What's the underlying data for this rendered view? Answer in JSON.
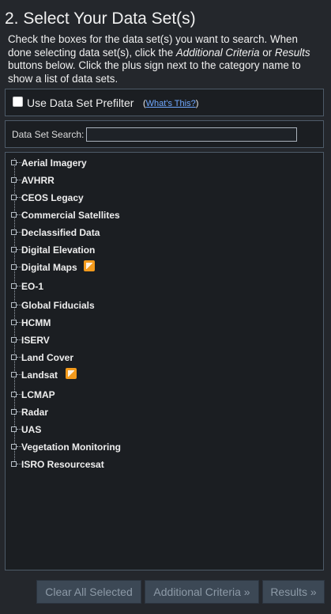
{
  "header": {
    "title": "2. Select Your Data Set(s)"
  },
  "intro": {
    "part1": "Check the boxes for the data set(s) you want to search. When done selecting data set(s), click the ",
    "italic1": "Additional Criteria",
    "part2": " or ",
    "italic2": "Results",
    "part3": " buttons below. Click the plus sign next to the category name to show a list of data sets."
  },
  "prefilter": {
    "label": "Use Data Set Prefilter",
    "paren_open": "(",
    "help_link": "What's This?",
    "paren_close": ")",
    "checked": false
  },
  "search": {
    "label": "Data Set Search:",
    "value": ""
  },
  "tree": {
    "nodes": [
      {
        "label": "Aerial Imagery",
        "badge": false
      },
      {
        "label": "AVHRR",
        "badge": false
      },
      {
        "label": "CEOS Legacy",
        "badge": false
      },
      {
        "label": "Commercial Satellites",
        "badge": false
      },
      {
        "label": "Declassified Data",
        "badge": false
      },
      {
        "label": "Digital Elevation",
        "badge": false
      },
      {
        "label": "Digital Maps",
        "badge": true
      },
      {
        "label": "EO-1",
        "badge": false
      },
      {
        "label": "Global Fiducials",
        "badge": false
      },
      {
        "label": "HCMM",
        "badge": false
      },
      {
        "label": "ISERV",
        "badge": false
      },
      {
        "label": "Land Cover",
        "badge": false
      },
      {
        "label": "Landsat",
        "badge": true
      },
      {
        "label": "LCMAP",
        "badge": false
      },
      {
        "label": "Radar",
        "badge": false
      },
      {
        "label": "UAS",
        "badge": false
      },
      {
        "label": "Vegetation Monitoring",
        "badge": false
      },
      {
        "label": "ISRO Resourcesat",
        "badge": false
      }
    ],
    "expand_icon": "plus-square-icon",
    "badge_icon": "external-link-icon",
    "badge_color": "#f39a1c"
  },
  "buttons": {
    "clear": "Clear All Selected",
    "additional": "Additional Criteria »",
    "results": "Results »"
  },
  "colors": {
    "background": "#24272c",
    "panel": "#1b1e22",
    "border": "#4d5a68",
    "link": "#6fa8ff",
    "button": "#3c4855",
    "button_text": "#8d9aa7"
  }
}
